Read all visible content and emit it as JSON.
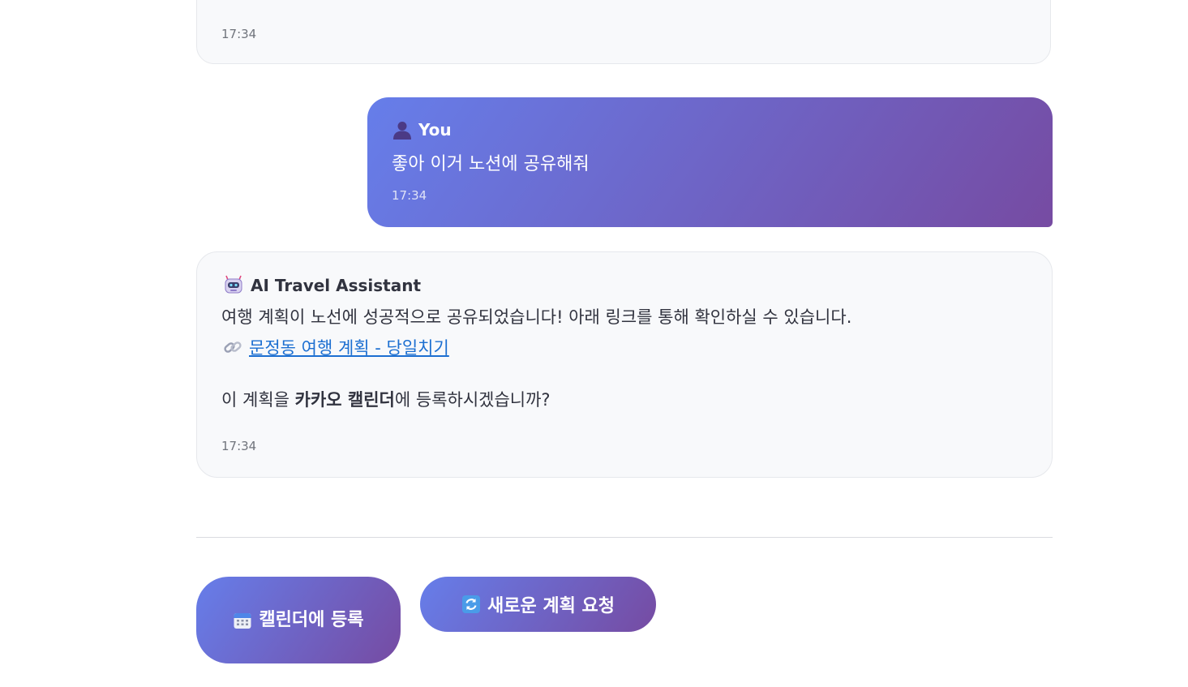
{
  "chat": {
    "messages": [
      {
        "role": "assistant",
        "time": "17:34"
      },
      {
        "role": "user",
        "sender": "You",
        "icon": "user-silhouette-icon",
        "text": "좋아 이거 노션에 공유해줘",
        "time": "17:34"
      },
      {
        "role": "assistant",
        "sender": "AI Travel Assistant",
        "icon": "robot-icon",
        "line1": "여행 계획이 노선에 성공적으로 공유되었습니다! 아래 링크를 통해 확인하실 수 있습니다.",
        "link_icon": "link-icon",
        "link_text": "문정동 여행 계획 - 당일치기",
        "question_prefix": "이 계획을 ",
        "question_bold": "카카오 캘린더",
        "question_suffix": "에 등록하시겠습니까?",
        "time": "17:34"
      }
    ]
  },
  "actions": {
    "calendar_button": {
      "icon": "calendar-icon",
      "label": "캘린더에 등록"
    },
    "new_plan_button": {
      "icon": "refresh-icon",
      "label": "새로운 계획 요청"
    }
  },
  "colors": {
    "gradient_start": "#667eea",
    "gradient_end": "#764ba2",
    "link": "#1c6fd1",
    "bubble_bg": "#f8f9fb"
  }
}
